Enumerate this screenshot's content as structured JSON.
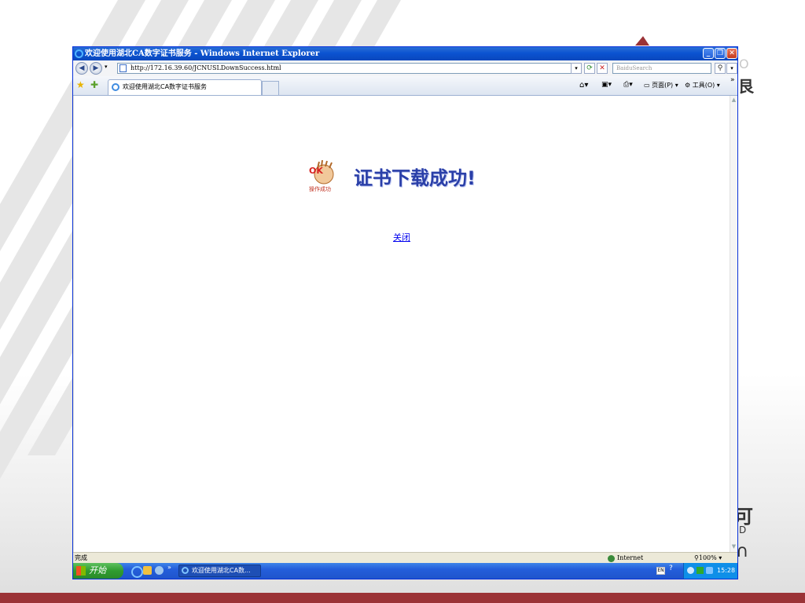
{
  "window": {
    "title": "欢迎使用湖北CA数字证书服务 - Windows Internet Explorer"
  },
  "address": {
    "url": "http://172.16.39.60/JCNUSLDownSuccess.html",
    "search_placeholder": "BaiduSearch"
  },
  "tabs": [
    {
      "label": "欢迎使用湖北CA数字证书服务"
    }
  ],
  "command_bar": {
    "page_label": "页面(P)",
    "tools_label": "工具(O)"
  },
  "content": {
    "headline": "证书下载成功!",
    "close_link": "关闭"
  },
  "status": {
    "text": "完成",
    "zone": "Internet",
    "zoom": "100%"
  },
  "taskbar": {
    "start_label": "开始",
    "task_item": "欢迎使用湖北CA数...",
    "clock": "15:28"
  },
  "colors": {
    "title_bar": "#0b53d1",
    "headline": "#2a3fa8",
    "slide_bottom_bar": "#9b3337"
  }
}
